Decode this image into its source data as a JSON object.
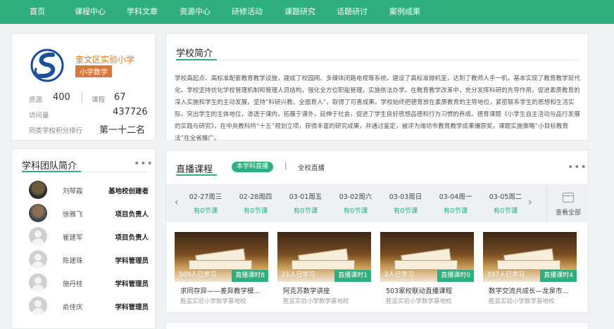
{
  "nav": [
    "首页",
    "课程中心",
    "学科文章",
    "资源中心",
    "研修活动",
    "课题研究",
    "话题研讨",
    "案例成果"
  ],
  "profile": {
    "name": "奎文区实验小学",
    "tag": "小学数学",
    "resources_label": "资源",
    "resources_value": "400",
    "courses_label": "课程",
    "courses_value": "67",
    "visits_label": "访问量",
    "visits_value": "437726",
    "rank_label": "同类学校积分排行",
    "rank_value": "第一十二名"
  },
  "intro": {
    "title": "学校简介",
    "text": "学校高起点、高标准配套教育教学设施，建成了校园网、多媒体闭路电视等系统，建设了高标准微机室，达到了教师人手一机，基本实现了教育教学现代化。学校坚持优化学校管理机制和管理人员结构，强化全方位职能管理，实施依法办学。在教育教学改革中，充分发挥科研的先导作用，促进素质教育的深入实施和学生的主动发展，坚持“科研兴教、全面育人”，取得了可喜成果。学校始终把德育放在素质教育的主导地位，紧密联系学生的思想和生活实际，突出学生的主体地位，渗透于课内，拓展于课外，延伸于社会，促进了学生良好思想品德和行为习惯的养成。德育课题《小学生自主活动与品行发展的实践与研究》，在中央教科所“十五”规划立项，获得丰富的研究成果，并通过鉴定，被评为潍坊市教育教学成果爆原奖，课题实施策略“小目标教育法”在全省推广。"
  },
  "team": {
    "title": "学科团队简介",
    "more": "•••",
    "members": [
      {
        "name": "刘琴霞",
        "role": "基地校创建者"
      },
      {
        "name": "徐雅飞",
        "role": "项目负责人"
      },
      {
        "name": "崔建军",
        "role": "项目负责人"
      },
      {
        "name": "陈建珠",
        "role": "学科管理员"
      },
      {
        "name": "施丹桂",
        "role": "学科管理员"
      },
      {
        "name": "俞佳庆",
        "role": "学科管理员"
      }
    ]
  },
  "live": {
    "title": "直播课程",
    "tab_active": "本学科直播",
    "tab_sep": "|",
    "tab_other": "全校直播",
    "more": "•••",
    "prev": "‹",
    "next": "›",
    "view_all": "查看全部",
    "dates": [
      {
        "date": "02-27周三",
        "count": "有0节课"
      },
      {
        "date": "02-28周四",
        "count": "有0节课"
      },
      {
        "date": "03-01周五",
        "count": "有0节课"
      },
      {
        "date": "03-02周六",
        "count": "有0节课"
      },
      {
        "date": "03-03周日",
        "count": "有0节课"
      },
      {
        "date": "03-04周一",
        "count": "有0节课"
      },
      {
        "date": "03-05周二",
        "count": "有0节课"
      }
    ],
    "courses": [
      {
        "learners": "509人已学习",
        "badge": "直播课时8",
        "title": "求同存异——差异教学模...",
        "school": "胜蓝实验小学数学基地校"
      },
      {
        "learners": "21人已学习",
        "badge": "直播课时1",
        "title": "阿克苏数学讲座",
        "school": "胜蓝实验小学数学基地校"
      },
      {
        "learners": "2人已学习",
        "badge": "直播课时0",
        "title": "503家校联动直播课程",
        "school": "胜蓝实验小学数学基地校"
      },
      {
        "learners": "597人已学习",
        "badge": "直播课时4",
        "title": "数学交流共成长—龙泉市...",
        "school": "胜蓝实验小学数学基地校"
      }
    ]
  }
}
